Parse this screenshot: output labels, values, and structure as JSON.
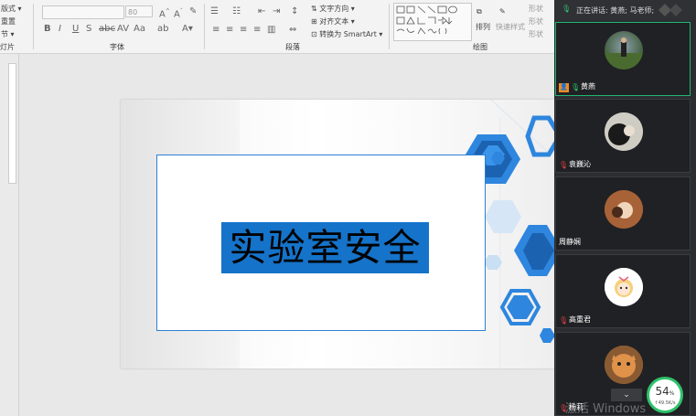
{
  "ribbon": {
    "left_items": [
      "版式",
      "重置",
      "节",
      "灯片"
    ],
    "font_size": "80",
    "groups": {
      "font": "字体",
      "paragraph": "段落",
      "drawing": "绘图"
    },
    "paragraph_tools": [
      "文字方向",
      "对齐文本",
      "转换为 SmartArt"
    ],
    "arrange": "排列",
    "quick_styles": "快速样式",
    "shape_fill": [
      "形状",
      "形状",
      "形状"
    ]
  },
  "slide": {
    "title": "实验室安全"
  },
  "meeting": {
    "speaking": "正在讲话: 黄燕; 马老师;",
    "participants": [
      {
        "name": "黄燕",
        "active": true
      },
      {
        "name": "袁巍沁",
        "active": false
      },
      {
        "name": "周静娴",
        "active": false
      },
      {
        "name": "高重君",
        "active": false
      },
      {
        "name": "杨莉",
        "active": false
      }
    ]
  },
  "network": {
    "percent": "54",
    "unit": "%",
    "rate": "↑49.5K/s"
  },
  "watermark": "激活 Windows",
  "colors": {
    "accent": "#1573c9",
    "hex": "#2e86de",
    "active_border": "#1fb873"
  }
}
